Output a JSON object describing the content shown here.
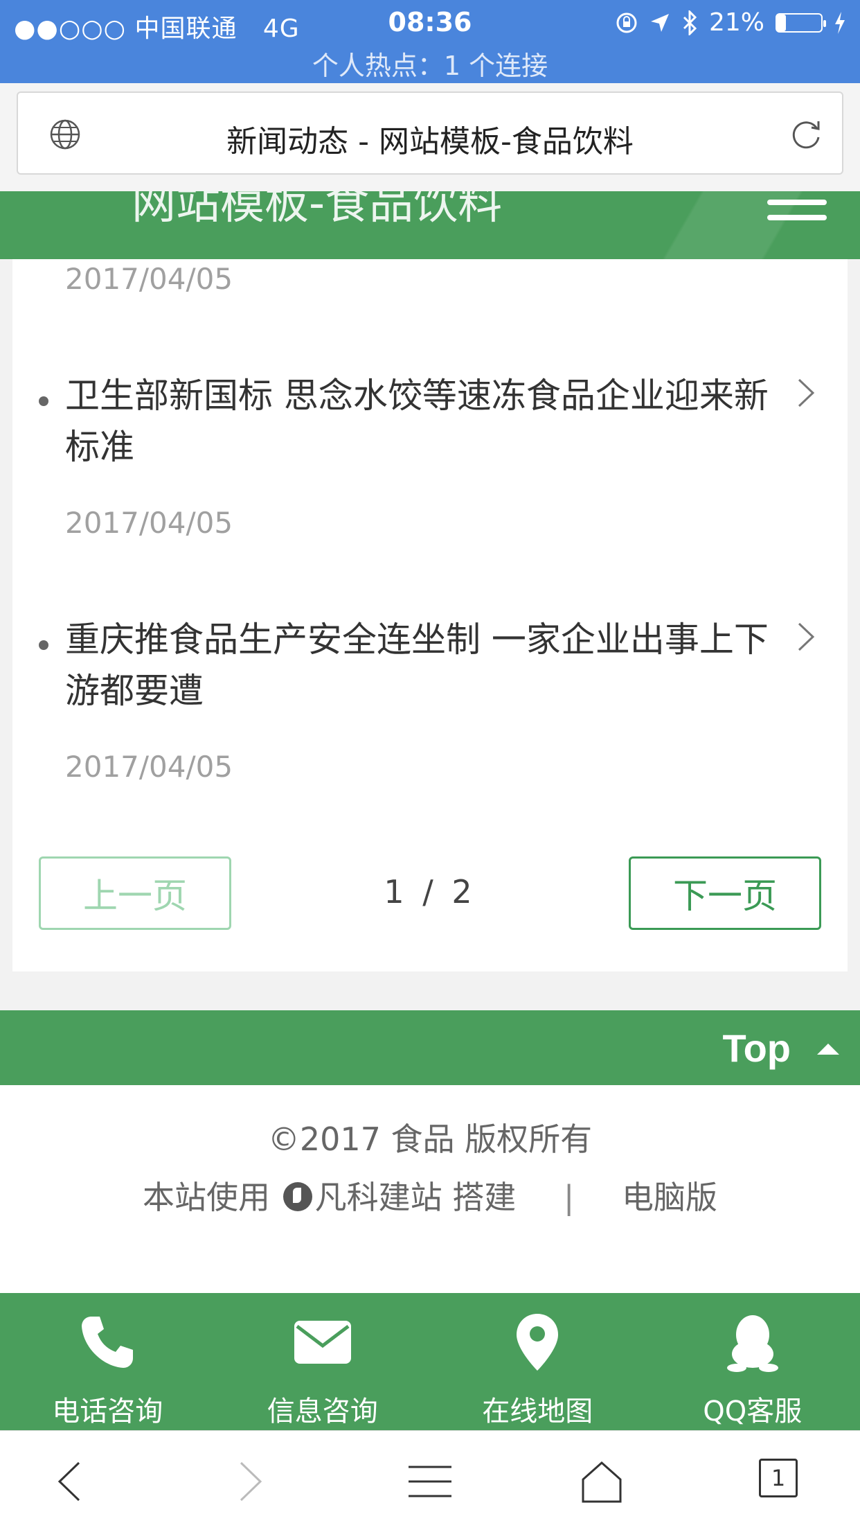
{
  "status_bar": {
    "carrier": "●●○○○ 中国联通",
    "network": "4G",
    "time": "08:36",
    "battery": "21%",
    "battery_level": 0.21,
    "hotspot": "个人热点：1 个连接"
  },
  "browser": {
    "page_title": "新闻动态 - 网站模板-食品饮料",
    "tab_count": "1"
  },
  "site": {
    "title": "网站模板-食品饮料"
  },
  "news": {
    "first_date": "2017/04/05",
    "items": [
      {
        "title": "卫生部新国标 思念水饺等速冻食品企业迎来新标准",
        "date": "2017/04/05"
      },
      {
        "title": "重庆推食品生产安全连坐制 一家企业出事上下游都要遭",
        "date": "2017/04/05"
      }
    ]
  },
  "pager": {
    "prev": "上一页",
    "next": "下一页",
    "current": "1 / 2"
  },
  "top_bar": {
    "label": "Top"
  },
  "footer": {
    "copyright": "©2017 食品 版权所有",
    "powered_prefix": "本站使用",
    "powered_brand": "凡科建站",
    "powered_suffix": "搭建",
    "separator": "|",
    "desktop_link": "电脑版"
  },
  "bottom_nav": [
    {
      "label": "电话咨询",
      "icon": "phone-icon"
    },
    {
      "label": "信息咨询",
      "icon": "mail-icon"
    },
    {
      "label": "在线地图",
      "icon": "map-pin-icon"
    },
    {
      "label": "QQ客服",
      "icon": "qq-icon"
    }
  ],
  "colors": {
    "status_bar": "#4a85dc",
    "brand_green": "#4a9e5c",
    "pager_next": "#3b9a55",
    "pager_prev_disabled": "#9fd6b0"
  }
}
